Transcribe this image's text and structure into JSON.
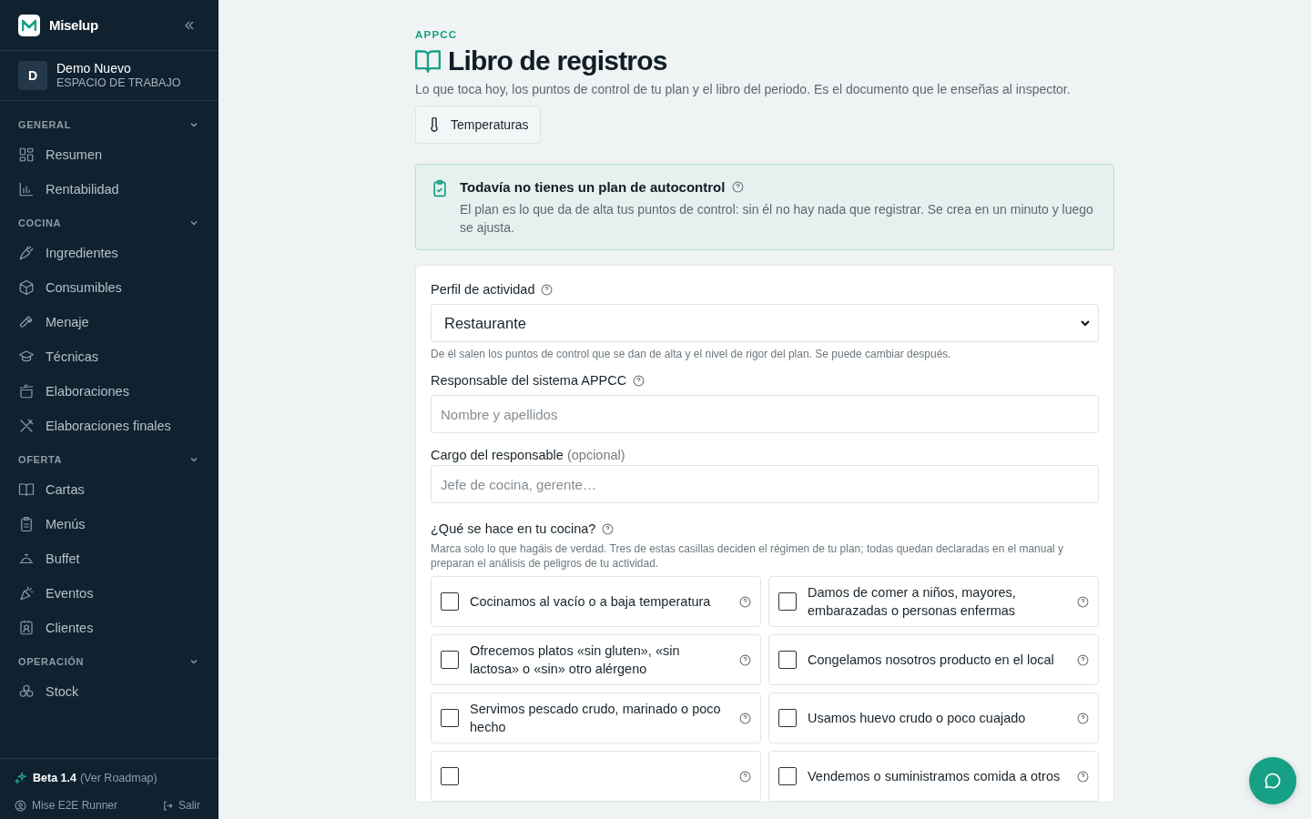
{
  "sidebar": {
    "brand": "Miselup",
    "workspace": {
      "initial": "D",
      "name": "Demo Nuevo",
      "label": "ESPACIO DE TRABAJO"
    },
    "sections": [
      {
        "title": "GENERAL",
        "expanded": true,
        "items": [
          {
            "label": "Resumen"
          },
          {
            "label": "Rentabilidad"
          }
        ]
      },
      {
        "title": "COCINA",
        "expanded": true,
        "items": [
          {
            "label": "Ingredientes"
          },
          {
            "label": "Consumibles"
          },
          {
            "label": "Menaje"
          },
          {
            "label": "Técnicas"
          },
          {
            "label": "Elaboraciones"
          },
          {
            "label": "Elaboraciones finales"
          }
        ]
      },
      {
        "title": "OFERTA",
        "expanded": true,
        "items": [
          {
            "label": "Cartas"
          },
          {
            "label": "Menús"
          },
          {
            "label": "Buffet"
          },
          {
            "label": "Eventos"
          },
          {
            "label": "Clientes"
          }
        ]
      },
      {
        "title": "OPERACIÓN",
        "expanded": true,
        "items": [
          {
            "label": "Stock"
          }
        ]
      }
    ],
    "beta": {
      "version": "Beta 1.4",
      "link": "(Ver Roadmap)"
    },
    "user": {
      "name": "Mise E2E Runner",
      "logout": "Salir"
    }
  },
  "page": {
    "eyebrow": "APPCC",
    "title": "Libro de registros",
    "subtitle": "Lo que toca hoy, los puntos de control de tu plan y el libro del periodo. Es el documento que le enseñas al inspector.",
    "tab": "Temperaturas"
  },
  "notice": {
    "title": "Todavía no tienes un plan de autocontrol",
    "text": "El plan es lo que da de alta tus puntos de control: sin él no hay nada que registrar. Se crea en un minuto y luego se ajusta."
  },
  "form": {
    "profile": {
      "label": "Perfil de actividad",
      "value": "Restaurante",
      "hint": "De él salen los puntos de control que se dan de alta y el nivel de rigor del plan. Se puede cambiar después."
    },
    "responsible": {
      "label": "Responsable del sistema APPCC",
      "placeholder": "Nombre y apellidos"
    },
    "role": {
      "label": "Cargo del responsable",
      "optional": "(opcional)",
      "placeholder": "Jefe de cocina, gerente…"
    },
    "activities": {
      "label": "¿Qué se hace en tu cocina?",
      "hint": "Marca solo lo que hagáis de verdad. Tres de estas casillas deciden el régimen de tu plan; todas quedan declaradas en el manual y preparan el análisis de peligros de tu actividad.",
      "options": [
        {
          "text": "Cocinamos al vacío o a baja temperatura",
          "checked": false
        },
        {
          "text": "Damos de comer a niños, mayores, embarazadas o personas enfermas",
          "checked": false
        },
        {
          "text": "Ofrecemos platos «sin gluten», «sin lactosa» o «sin» otro alérgeno",
          "checked": false
        },
        {
          "text": "Congelamos nosotros producto en el local",
          "checked": false
        },
        {
          "text": "Servimos pescado crudo, marinado o poco hecho",
          "checked": false
        },
        {
          "text": "Usamos huevo crudo o poco cuajado",
          "checked": false
        },
        {
          "checked": false
        },
        {
          "text": "Vendemos o suministramos comida a otros",
          "checked": false
        }
      ]
    }
  }
}
